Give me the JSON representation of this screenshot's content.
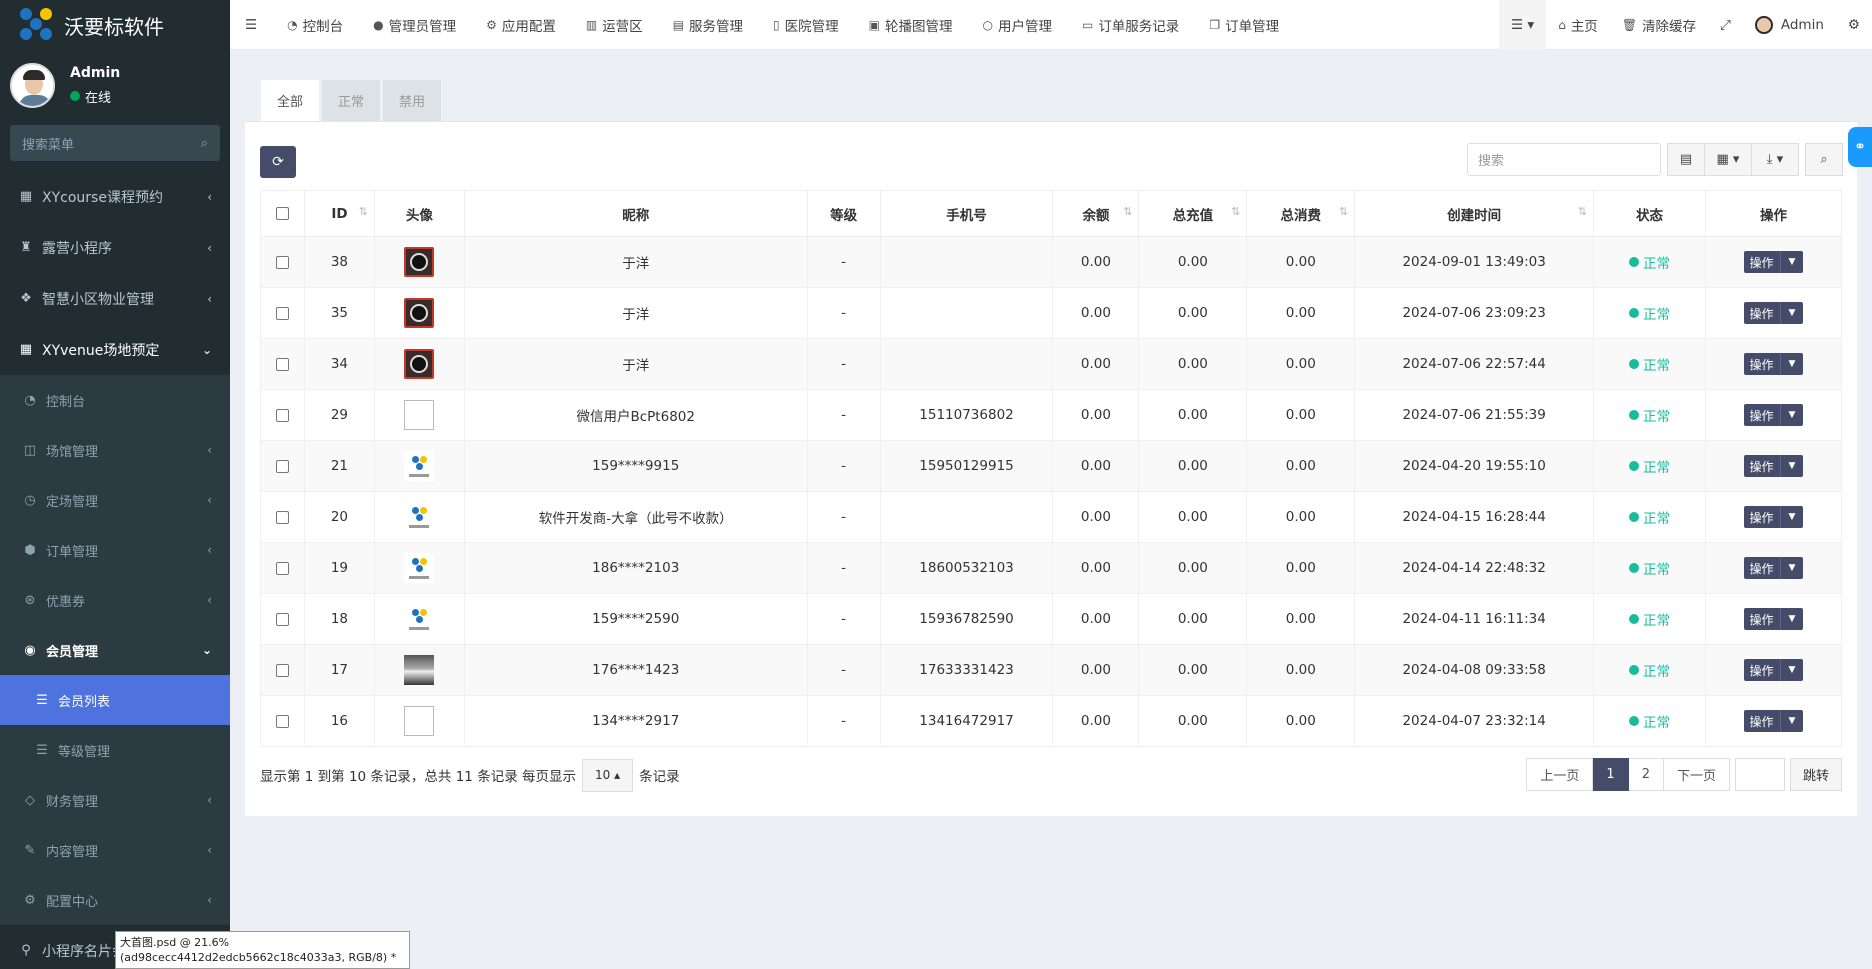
{
  "app": {
    "name": "沃要标软件"
  },
  "user": {
    "name": "Admin",
    "status": "在线"
  },
  "sidebar": {
    "search_placeholder": "搜索菜单",
    "items": [
      {
        "label": "XYcourse课程预约",
        "icon": "grid-icon"
      },
      {
        "label": "露营小程序",
        "icon": "tent-icon"
      },
      {
        "label": "智慧小区物业管理",
        "icon": "cubes-icon"
      },
      {
        "label": "XYvenue场地预定",
        "icon": "grid-icon"
      }
    ],
    "sub": [
      {
        "label": "控制台"
      },
      {
        "label": "场馆管理"
      },
      {
        "label": "定场管理"
      },
      {
        "label": "订单管理"
      },
      {
        "label": "优惠券"
      },
      {
        "label": "会员管理"
      },
      {
        "label": "会员列表"
      },
      {
        "label": "等级管理"
      },
      {
        "label": "财务管理"
      },
      {
        "label": "内容管理"
      },
      {
        "label": "配置中心"
      },
      {
        "label": "小程序名片会"
      }
    ]
  },
  "header": {
    "nav": [
      "控制台",
      "管理员管理",
      "应用配置",
      "运营区",
      "服务管理",
      "医院管理",
      "轮播图管理",
      "用户管理",
      "订单服务记录",
      "订单管理"
    ],
    "home": "主页",
    "clear_cache": "清除缓存",
    "admin": "Admin"
  },
  "tabs": [
    "全部",
    "正常",
    "禁用"
  ],
  "toolbar": {
    "search_placeholder": "搜索"
  },
  "table": {
    "headers": [
      "ID",
      "头像",
      "昵称",
      "等级",
      "手机号",
      "余额",
      "总充值",
      "总消费",
      "创建时间",
      "状态",
      "操作"
    ],
    "rows": [
      {
        "id": "38",
        "avatar": "benz",
        "nickname": "于洋",
        "level": "-",
        "phone": "",
        "balance": "0.00",
        "recharge": "0.00",
        "consume": "0.00",
        "created": "2024-09-01 13:49:03",
        "status": "正常"
      },
      {
        "id": "35",
        "avatar": "benz",
        "nickname": "于洋",
        "level": "-",
        "phone": "",
        "balance": "0.00",
        "recharge": "0.00",
        "consume": "0.00",
        "created": "2024-07-06 23:09:23",
        "status": "正常"
      },
      {
        "id": "34",
        "avatar": "benz",
        "nickname": "于洋",
        "level": "-",
        "phone": "",
        "balance": "0.00",
        "recharge": "0.00",
        "consume": "0.00",
        "created": "2024-07-06 22:57:44",
        "status": "正常"
      },
      {
        "id": "29",
        "avatar": "broken",
        "nickname": "微信用户BcPt6802",
        "level": "-",
        "phone": "15110736802",
        "balance": "0.00",
        "recharge": "0.00",
        "consume": "0.00",
        "created": "2024-07-06 21:55:39",
        "status": "正常"
      },
      {
        "id": "21",
        "avatar": "logo",
        "nickname": "159****9915",
        "level": "-",
        "phone": "15950129915",
        "balance": "0.00",
        "recharge": "0.00",
        "consume": "0.00",
        "created": "2024-04-20 19:55:10",
        "status": "正常"
      },
      {
        "id": "20",
        "avatar": "logo",
        "nickname": "软件开发商-大拿（此号不收款）",
        "level": "-",
        "phone": "",
        "balance": "0.00",
        "recharge": "0.00",
        "consume": "0.00",
        "created": "2024-04-15 16:28:44",
        "status": "正常"
      },
      {
        "id": "19",
        "avatar": "logo",
        "nickname": "186****2103",
        "level": "-",
        "phone": "18600532103",
        "balance": "0.00",
        "recharge": "0.00",
        "consume": "0.00",
        "created": "2024-04-14 22:48:32",
        "status": "正常"
      },
      {
        "id": "18",
        "avatar": "logo",
        "nickname": "159****2590",
        "level": "-",
        "phone": "15936782590",
        "balance": "0.00",
        "recharge": "0.00",
        "consume": "0.00",
        "created": "2024-04-11 16:11:34",
        "status": "正常"
      },
      {
        "id": "17",
        "avatar": "photo",
        "nickname": "176****1423",
        "level": "-",
        "phone": "17633331423",
        "balance": "0.00",
        "recharge": "0.00",
        "consume": "0.00",
        "created": "2024-04-08 09:33:58",
        "status": "正常"
      },
      {
        "id": "16",
        "avatar": "broken",
        "nickname": "134****2917",
        "level": "-",
        "phone": "13416472917",
        "balance": "0.00",
        "recharge": "0.00",
        "consume": "0.00",
        "created": "2024-04-07 23:32:14",
        "status": "正常"
      }
    ],
    "op_label": "操作"
  },
  "footer": {
    "info_prefix": "显示第 1 到第 10 条记录，总共 11 条记录 每页显示",
    "page_size": "10",
    "info_suffix": "条记录",
    "prev": "上一页",
    "pages": [
      "1",
      "2"
    ],
    "next": "下一页",
    "jump": "跳转"
  },
  "tooltip": {
    "line1": "大首图.psd @ 21.6%",
    "line2": "(ad98cecc4412d2edcb5662c18c4033a3, RGB/8) *"
  },
  "colors": {
    "sidebar": "#222d32",
    "primary": "#444c69",
    "active": "#4e73df",
    "ok": "#18bc9c"
  }
}
